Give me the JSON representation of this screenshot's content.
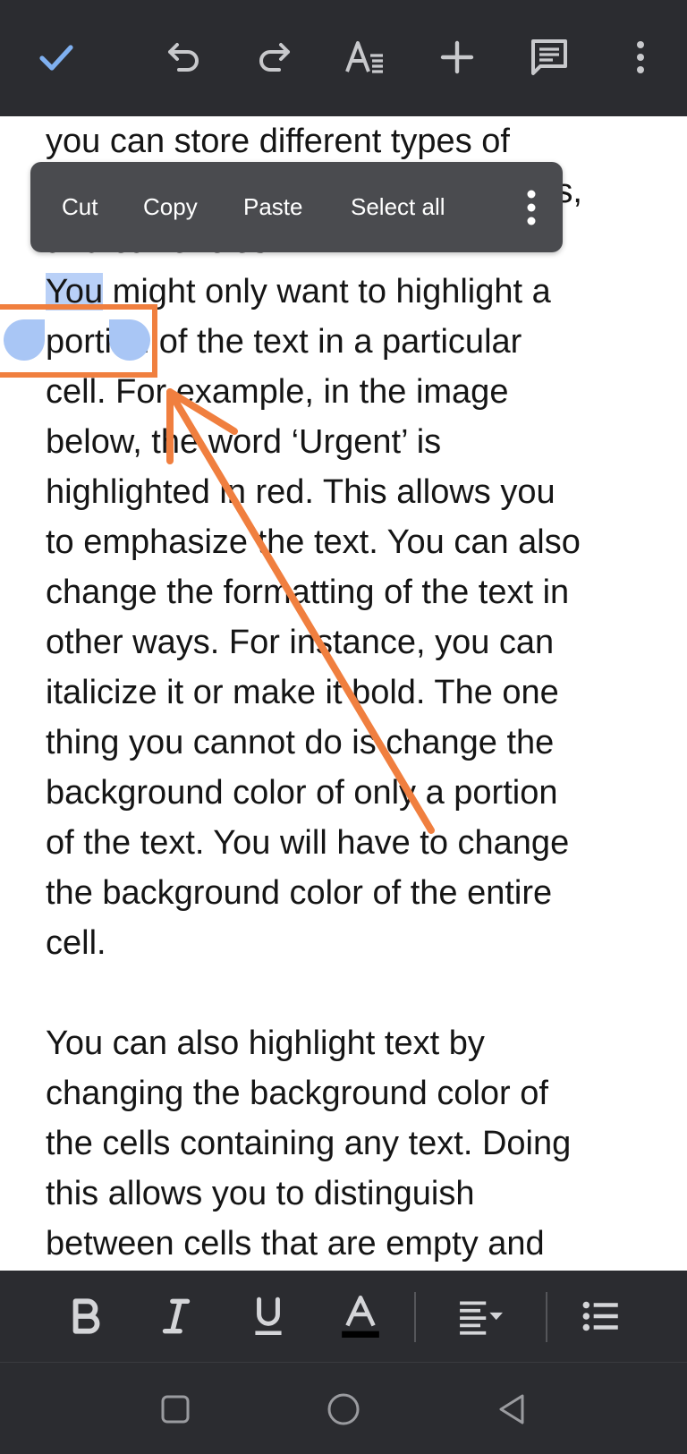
{
  "toolbar": {
    "icons": [
      "check-icon",
      "undo-icon",
      "redo-icon",
      "text-format-icon",
      "insert-icon",
      "comment-icon",
      "more-vert-icon"
    ]
  },
  "document": {
    "lines_before": [
      "you can store different types of",
      "data like numbers, dates and times,",
      "and currencies."
    ],
    "selected_word": "You",
    "line_after_selection": " might only want to highlight a",
    "lines_after": [
      "portion of the text in a particular",
      "cell. For example, in the image",
      "below, the word ‘Urgent’ is",
      "highlighted in red. This allows you",
      "to emphasize the text. You can also",
      "change the formatting of the text in",
      "other ways. For instance, you can",
      "italicize it or make it bold. The one",
      "thing you cannot do is change the",
      "background color of only a portion",
      "of the text. You will have to change",
      "the background color of the entire",
      "cell."
    ],
    "paragraph2": [
      "You can also highlight text by",
      "changing the background color of",
      "the cells containing any text. Doing",
      "this allows you to distinguish",
      "between cells that are empty and"
    ]
  },
  "context_menu": {
    "cut": "Cut",
    "copy": "Copy",
    "paste": "Paste",
    "select_all": "Select all"
  },
  "colors": {
    "bar_bg": "#2b2c30",
    "menu_bg": "#4a4b4f",
    "selection": "#b9d0f7",
    "handle": "#a9c6f5",
    "accent_check": "#7fb0f0",
    "annotation": "#f07f3f"
  }
}
